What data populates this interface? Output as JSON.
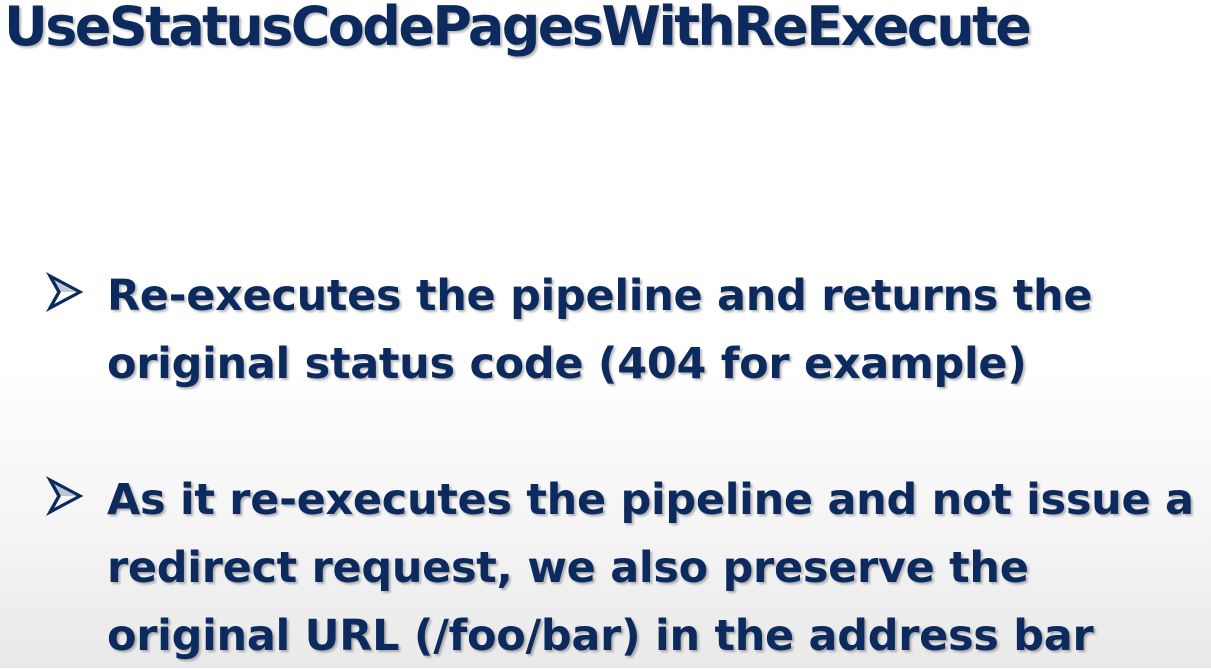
{
  "slide": {
    "title": "UseStatusCodePagesWithReExecute",
    "bullets": [
      {
        "icon": "arrowhead-bullet-icon",
        "lines": [
          "Re-executes the pipeline and returns the",
          "original status code (404 for example)"
        ]
      },
      {
        "icon": "arrowhead-bullet-icon",
        "lines": [
          "As it re-executes the pipeline and not issue a",
          "redirect request, we also preserve the",
          "original URL (/foo/bar) in the address bar"
        ]
      }
    ],
    "colors": {
      "text": "#0c2a5e",
      "background": "#ffffff"
    }
  }
}
